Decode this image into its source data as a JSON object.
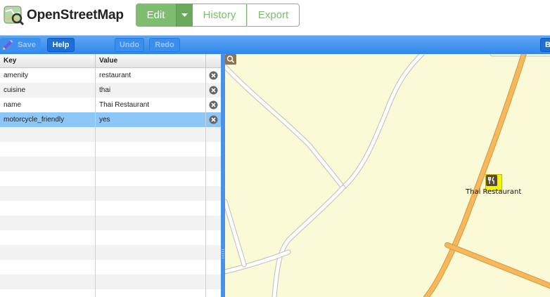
{
  "header": {
    "brand": "OpenStreetMap",
    "edit_label": "Edit",
    "history_label": "History",
    "export_label": "Export",
    "accent": "#7ebc6f"
  },
  "toolbar": {
    "save_label": "Save",
    "help_label": "Help",
    "undo_label": "Undo",
    "redo_label": "Redo",
    "right_label": "B"
  },
  "tags": {
    "headers": {
      "key": "Key",
      "value": "Value"
    },
    "rows": [
      {
        "key": "amenity",
        "value": "restaurant"
      },
      {
        "key": "cuisine",
        "value": "thai"
      },
      {
        "key": "name",
        "value": "Thai Restaurant"
      },
      {
        "key": "motorcycle_friendly",
        "value": "yes"
      }
    ]
  },
  "map": {
    "poi_label": "Thai Restaurant",
    "poi_icon": "restaurant-icon"
  }
}
